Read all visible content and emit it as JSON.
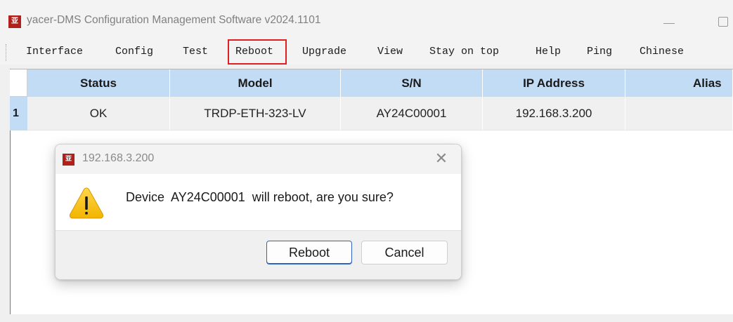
{
  "window": {
    "logo_text": "亚",
    "title": "yacer-DMS Configuration Management Software v2024.1101"
  },
  "menu": [
    {
      "label": "Interface"
    },
    {
      "label": "Config"
    },
    {
      "label": "Test"
    },
    {
      "label": "Reboot"
    },
    {
      "label": "Upgrade"
    },
    {
      "label": "View"
    },
    {
      "label": "Stay on top"
    },
    {
      "label": "Help"
    },
    {
      "label": "Ping"
    },
    {
      "label": "Chinese"
    }
  ],
  "table": {
    "columns": [
      "Status",
      "Model",
      "S/N",
      "IP Address",
      "Alias"
    ],
    "rows": [
      {
        "index": "1",
        "cells": [
          "OK",
          "TRDP-ETH-323-LV",
          "AY24C00001",
          "192.168.3.200",
          ""
        ]
      }
    ]
  },
  "dialog": {
    "logo_text": "亚",
    "title": "192.168.3.200",
    "close_glyph": "✕",
    "message": "Device  AY24C00001  will reboot, are you sure?",
    "confirm_label": "Reboot",
    "cancel_label": "Cancel",
    "icon": "warning-icon"
  },
  "colors": {
    "header_blue": "#c3dcf6",
    "highlight_red": "#e02020",
    "warning_yellow": "#f5c400"
  }
}
